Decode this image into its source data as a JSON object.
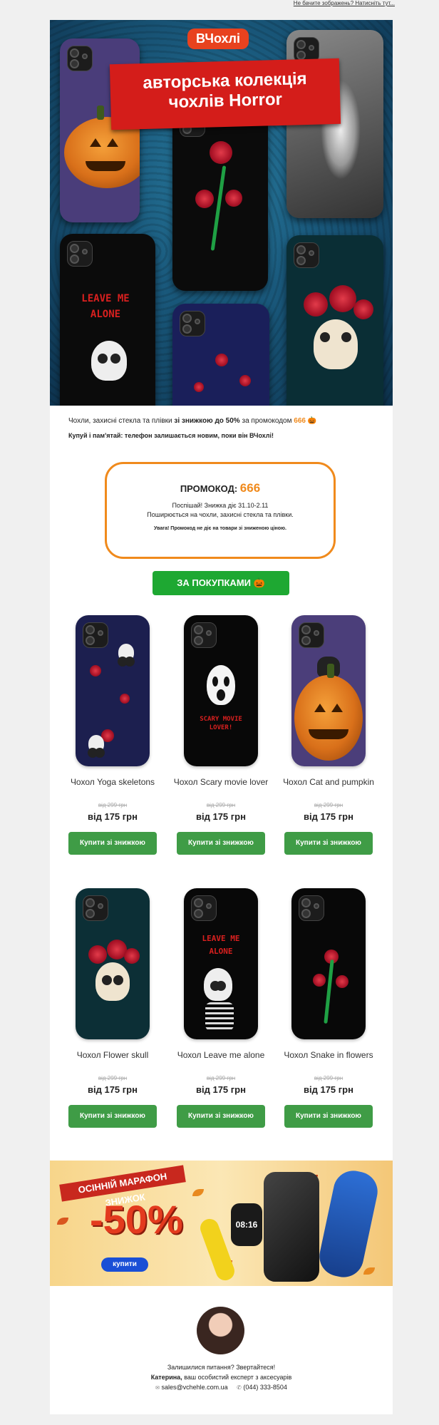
{
  "topline": "Не бачите зображень? Натисніть тут...",
  "hero": {
    "brand": "ВЧохлі",
    "title_line1": "авторська колекція",
    "title_line2": "чохлів Horror",
    "case_text": "LEAVE ME ALONE"
  },
  "promo": {
    "line1_prefix": "Чохли, захисні стекла та плівки ",
    "line1_bold": "зі знижкою до 50%",
    "line1_mid": " за промокодом ",
    "line1_code": "666",
    "line1_emoji": "🎃",
    "line2": "Купуй і пам'ятай: телефон залишається новим, поки він ВЧохлі!",
    "box_label": "ПРОМОКОД: ",
    "box_code": "666",
    "box_line1": "Поспішай! Знижка діє 31.10-2.11",
    "box_line2": "Поширюється на чохли, захисні стекла та плівки.",
    "box_warn": "Увага! Промокод не діє на товари зі зниженою ціною."
  },
  "cta": "ЗА ПОКУПКАМИ 🎃",
  "products": [
    {
      "name": "Чохол Yoga skeletons",
      "old": "від 299 грн",
      "price": "від 175 грн",
      "buy": "Купити зі знижкою"
    },
    {
      "name": "Чохол Scary movie lover",
      "old": "від 299 грн",
      "price": "від 175 грн",
      "buy": "Купити зі знижкою",
      "case_text": "SCARY MOVIE LOVER!"
    },
    {
      "name": "Чохол Cat and pumpkin",
      "old": "від 299 грн",
      "price": "від 175 грн",
      "buy": "Купити зі знижкою"
    },
    {
      "name": "Чохол Flower skull",
      "old": "від 299 грн",
      "price": "від 175 грн",
      "buy": "Купити зі знижкою"
    },
    {
      "name": "Чохол Leave me alone",
      "old": "від 299 грн",
      "price": "від 175 грн",
      "buy": "Купити зі знижкою",
      "case_text": "LEAVE ME ALONE"
    },
    {
      "name": "Чохол Snake in flowers",
      "old": "від 299 грн",
      "price": "від 175 грн",
      "buy": "Купити зі знижкою"
    }
  ],
  "autumn": {
    "ribbon": "ОСІННІЙ МАРАФОН ЗНИЖОК",
    "discount": "-50%",
    "button": "купити",
    "watch_time": "08:16"
  },
  "footer": {
    "question": "Залишилися питання? Звертайтеся!",
    "name": "Катерина,",
    "role": " ваш особистий експерт з аксесуарів",
    "email": "sales@vchehle.com.ua",
    "phone": "(044) 333-8504"
  },
  "colors": {
    "accent": "#f08a1c",
    "green": "#1ea832",
    "buy_green": "#3f9c46",
    "brand_red": "#e8421e"
  }
}
